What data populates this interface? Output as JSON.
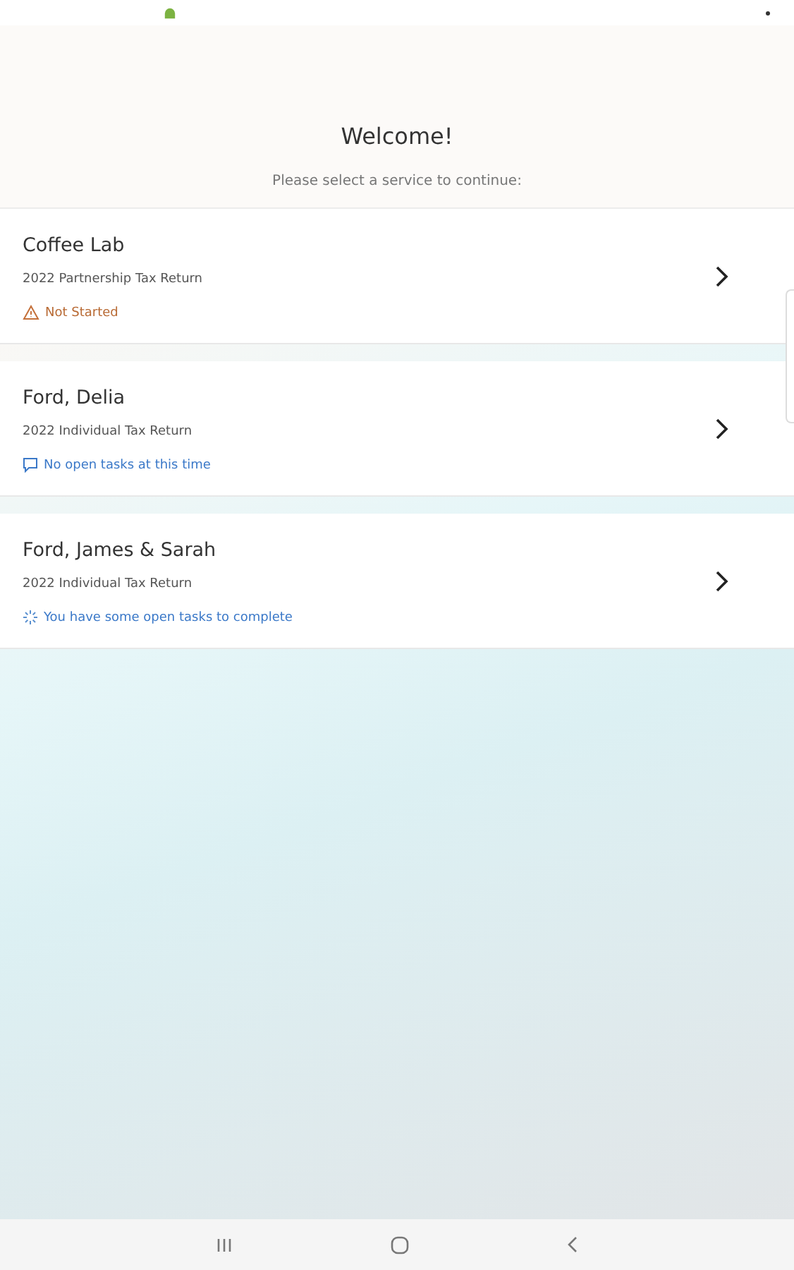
{
  "header": {
    "title": "Welcome!",
    "subtitle": "Please select a service to continue:"
  },
  "services": [
    {
      "name": "Coffee Lab",
      "description": "2022 Partnership Tax Return",
      "status": {
        "kind": "warning",
        "text": "Not Started"
      }
    },
    {
      "name": "Ford, Delia",
      "description": "2022 Individual Tax Return",
      "status": {
        "kind": "message",
        "text": "No open tasks at this time"
      }
    },
    {
      "name": "Ford, James & Sarah",
      "description": "2022 Individual Tax Return",
      "status": {
        "kind": "pending",
        "text": "You have some open tasks to complete"
      }
    }
  ]
}
